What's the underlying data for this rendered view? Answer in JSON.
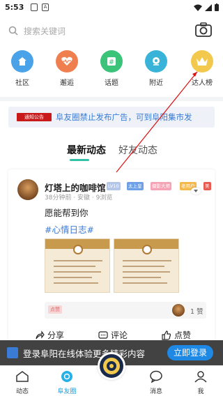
{
  "status_bar": {
    "time": "5:53",
    "badge1": "",
    "badge2": "A"
  },
  "search": {
    "placeholder": "搜索关键词"
  },
  "categories": [
    {
      "label": "社区",
      "color": "#4aa3e8",
      "icon": "house-icon"
    },
    {
      "label": "邂逅",
      "color": "#f07f4f",
      "icon": "heart-pulse-icon"
    },
    {
      "label": "话题",
      "color": "#3cc37a",
      "icon": "hash-icon"
    },
    {
      "label": "附近",
      "color": "#3ab3d8",
      "icon": "location-icon"
    },
    {
      "label": "达人榜",
      "color": "#f2c94c",
      "icon": "crown-icon"
    }
  ],
  "notice": {
    "tag": "通知公告",
    "text": "阜友圈禁止发布广告，可到阜阳集市发"
  },
  "tabs": {
    "active": "最新动态",
    "inactive": "好友动态"
  },
  "post": {
    "username": "灯塔上的咖啡馆",
    "badges": [
      {
        "text": "LV10",
        "color": "#b5c7e8"
      },
      {
        "text": "太上皇",
        "color": "#6ea0e8"
      },
      {
        "text": "摄影大师",
        "color": "#f5a3b5"
      },
      {
        "text": "老用户",
        "color": "#f5b84a"
      },
      {
        "text": "美",
        "color": "#e85a4f"
      }
    ],
    "meta": "38分钟前 · 安徽 · 9浏览",
    "text": "愿能帮到你",
    "hashtag": "#心情日志#",
    "like_tag": "点赞",
    "like_count": "1 赞"
  },
  "actions": {
    "share": "分享",
    "comment": "评论",
    "like": "点赞"
  },
  "login_banner": {
    "text": "登录阜阳在线体验更多精彩内容",
    "button": "立即登录"
  },
  "nav": {
    "items": [
      "动态",
      "阜友圈",
      "",
      "消息",
      "我"
    ]
  },
  "colors": {
    "accent": "#33c0a8",
    "link": "#3a7bd5",
    "primary": "#1e88e5"
  }
}
